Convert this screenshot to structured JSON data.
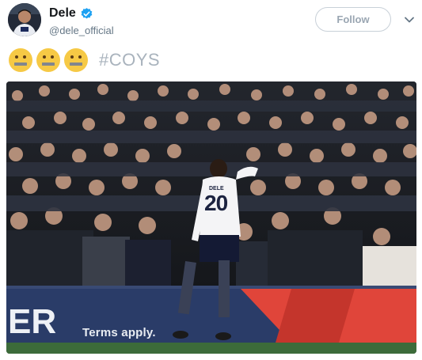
{
  "user": {
    "display_name": "Dele",
    "handle": "@dele_official",
    "verified": true,
    "verified_color": "#1da1f2"
  },
  "header": {
    "follow_label": "Follow",
    "menu_icon": "chevron-down-icon"
  },
  "tweet": {
    "emojis": [
      "zipper-mouth-face",
      "zipper-mouth-face",
      "zipper-mouth-face"
    ],
    "hashtag": "#COYS"
  },
  "media": {
    "description_visible_text": "Terms apply.",
    "ad_board_letters": "ER",
    "shirt_name": "DELE",
    "shirt_number": "20"
  },
  "colors": {
    "hashtag": "#a9b3bd",
    "follow_text": "#9aa6b2",
    "ad_board": "#2a3c68",
    "ad_accent": "#e0453a"
  }
}
